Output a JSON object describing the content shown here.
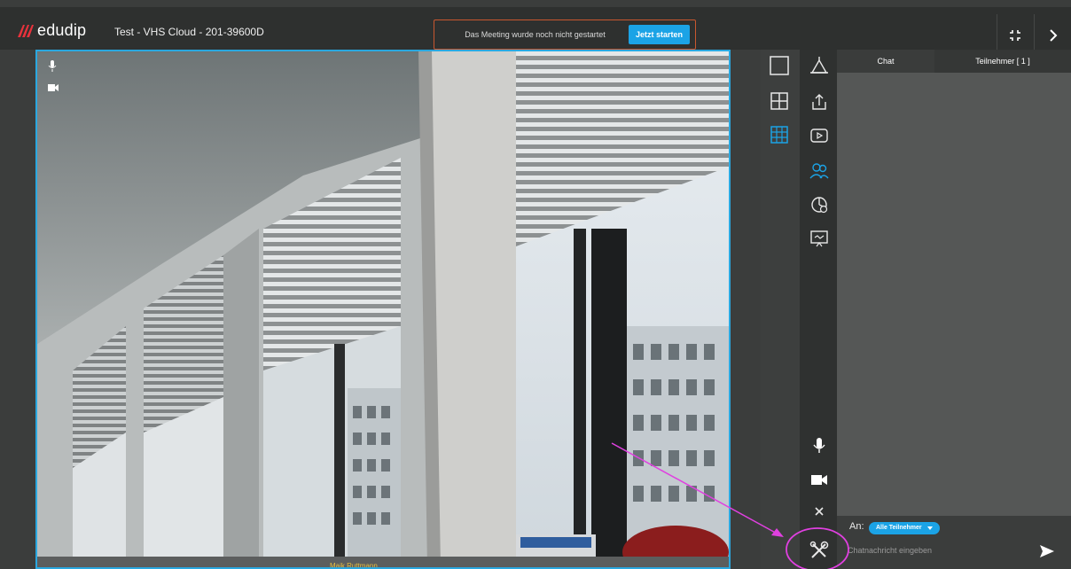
{
  "topbar": {
    "logo_text": "edudip",
    "meeting_title": "Test - VHS Cloud - 201-39600D",
    "status_text": "Das Meeting wurde noch nicht gestartet",
    "start_button": "Jetzt starten"
  },
  "video": {
    "participant_name": "Maik Ruttmann"
  },
  "chat": {
    "tab_chat": "Chat",
    "tab_participants": "Teilnehmer [ 1 ]",
    "to_label": "An:",
    "recipient": "Alle Teilnehmer",
    "input_placeholder": "Chatnachricht eingeben"
  },
  "colors": {
    "accent": "#1ba3e6",
    "brand_red": "#e8323c",
    "annotation": "#e040e0",
    "status_border": "#c9572f"
  },
  "icons": {
    "layout": [
      "single-view-icon",
      "quad-view-icon",
      "grid-view-icon"
    ],
    "tools_top": [
      "whiteboard-icon",
      "upload-icon",
      "video-play-icon",
      "participants-icon",
      "poll-icon",
      "screen-share-icon"
    ],
    "tools_bottom": [
      "microphone-icon",
      "camera-icon",
      "close-icon",
      "tools-icon"
    ]
  }
}
